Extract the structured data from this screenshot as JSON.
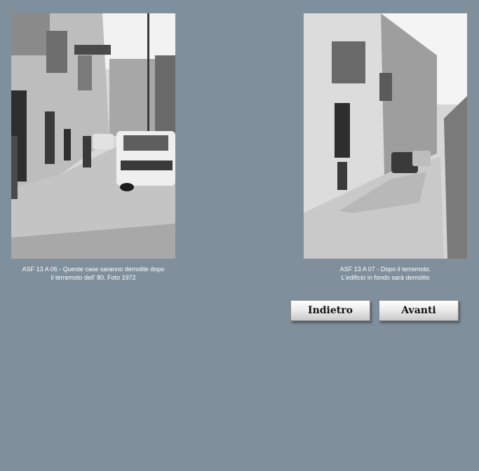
{
  "gallery": {
    "left": {
      "caption_line1": "ASF 13 A 06 - Queste case saranno demolite dopo",
      "caption_line2": "il terremoto dell' 80. Foto 1972"
    },
    "right": {
      "caption_line1": "ASF 13 A 07 - Dopo il terremoto.",
      "caption_line2": "L'edificio in fondo sarà demolito"
    }
  },
  "nav": {
    "back_label": "Indietro",
    "next_label": "Avanti"
  },
  "colors": {
    "background": "#7f8f9b",
    "caption_text": "#ffffff"
  }
}
